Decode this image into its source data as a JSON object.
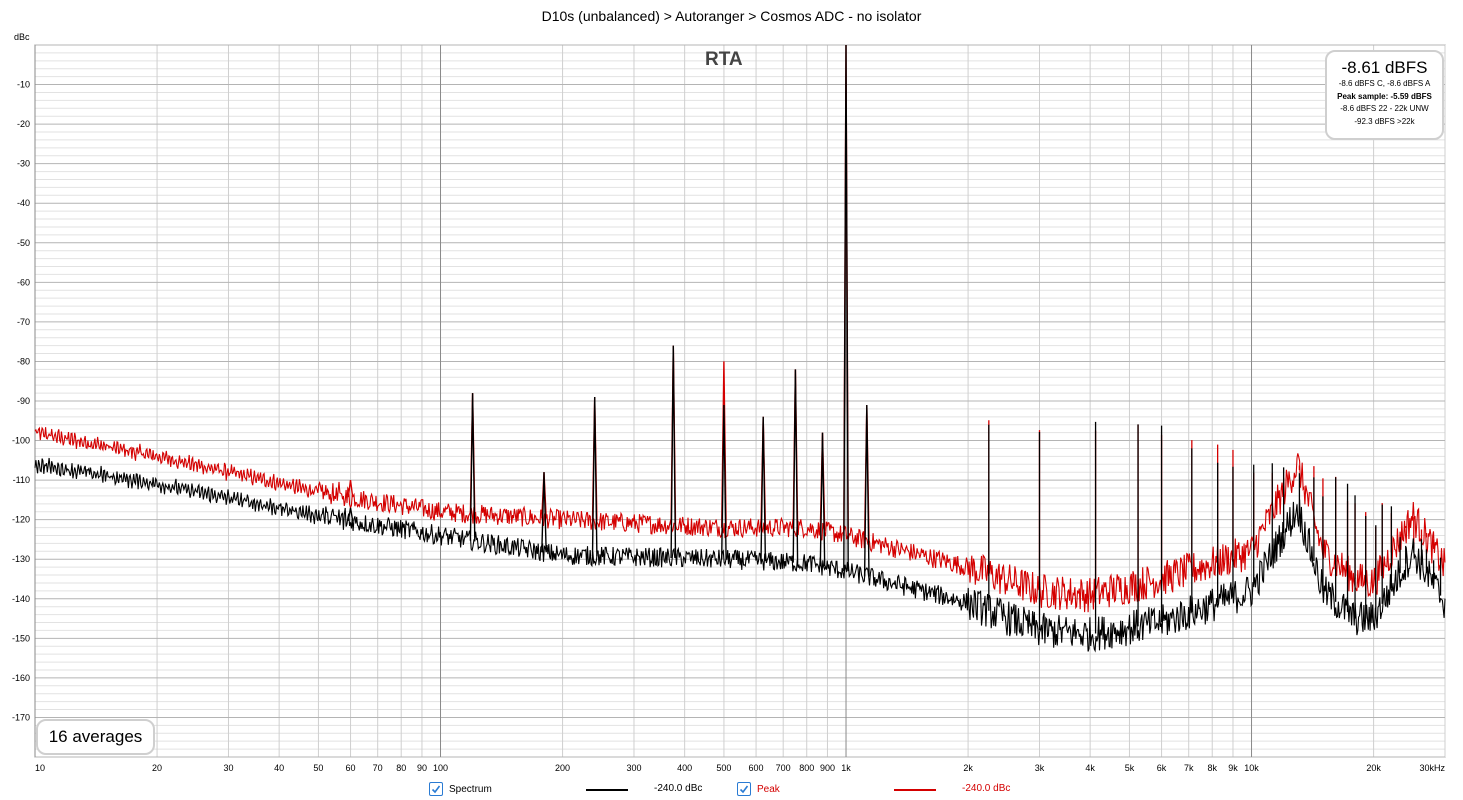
{
  "header": {
    "title": "D10s (unbalanced) > Autoranger > Cosmos ADC - no isolator"
  },
  "chart_data": {
    "type": "line",
    "title": "RTA",
    "ylabel": "dBc",
    "xscale": "log",
    "xlim": [
      10,
      30000
    ],
    "ylim": [
      -180,
      0
    ],
    "y_ticks": [
      -10,
      -20,
      -30,
      -40,
      -50,
      -60,
      -70,
      -80,
      -90,
      -100,
      -110,
      -120,
      -130,
      -140,
      -150,
      -160,
      -170
    ],
    "x_ticks": [
      {
        "v": 10,
        "label": "10"
      },
      {
        "v": 20,
        "label": "20"
      },
      {
        "v": 30,
        "label": "30"
      },
      {
        "v": 40,
        "label": "40"
      },
      {
        "v": 50,
        "label": "50"
      },
      {
        "v": 60,
        "label": "60"
      },
      {
        "v": 70,
        "label": "70"
      },
      {
        "v": 80,
        "label": "80"
      },
      {
        "v": 90,
        "label": "90"
      },
      {
        "v": 100,
        "label": "100"
      },
      {
        "v": 200,
        "label": "200"
      },
      {
        "v": 300,
        "label": "300"
      },
      {
        "v": 400,
        "label": "400"
      },
      {
        "v": 500,
        "label": "500"
      },
      {
        "v": 600,
        "label": "600"
      },
      {
        "v": 700,
        "label": "700"
      },
      {
        "v": 800,
        "label": "800"
      },
      {
        "v": 900,
        "label": "900"
      },
      {
        "v": 1000,
        "label": "1k"
      },
      {
        "v": 2000,
        "label": "2k"
      },
      {
        "v": 3000,
        "label": "3k"
      },
      {
        "v": 4000,
        "label": "4k"
      },
      {
        "v": 5000,
        "label": "5k"
      },
      {
        "v": 6000,
        "label": "6k"
      },
      {
        "v": 7000,
        "label": "7k"
      },
      {
        "v": 8000,
        "label": "8k"
      },
      {
        "v": 9000,
        "label": "9k"
      },
      {
        "v": 10000,
        "label": "10k"
      },
      {
        "v": 20000,
        "label": "20k"
      },
      {
        "v": 30000,
        "label": "30kHz"
      }
    ],
    "grid": true,
    "series": [
      {
        "name": "Spectrum",
        "color": "#000000",
        "x": [
          10,
          20,
          50,
          100,
          200,
          500,
          800,
          1000,
          2000,
          3000,
          4000,
          6000,
          10000,
          13000,
          15000,
          18000,
          20000,
          25000,
          30000
        ],
        "y": [
          -106,
          -111,
          -119,
          -124,
          -129,
          -130,
          -131,
          -133,
          -141,
          -148,
          -149,
          -146,
          -138,
          -117,
          -138,
          -145,
          -145,
          -128,
          -141
        ],
        "peaks": [
          {
            "f": 60,
            "db": -117
          },
          {
            "f": 120,
            "db": -88
          },
          {
            "f": 180,
            "db": -108
          },
          {
            "f": 240,
            "db": -89
          },
          {
            "f": 375,
            "db": -76
          },
          {
            "f": 500,
            "db": -91
          },
          {
            "f": 625,
            "db": -94
          },
          {
            "f": 750,
            "db": -82
          },
          {
            "f": 875,
            "db": -98
          },
          {
            "f": 1000,
            "db": 0
          },
          {
            "f": 1125,
            "db": -91
          }
        ]
      },
      {
        "name": "Peak",
        "color": "#d40000",
        "x": [
          10,
          20,
          50,
          100,
          200,
          500,
          800,
          1000,
          2000,
          3000,
          4000,
          6000,
          10000,
          13000,
          15000,
          18000,
          20000,
          25000,
          30000
        ],
        "y": [
          -98,
          -104,
          -113,
          -118,
          -120,
          -122,
          -122,
          -124,
          -132,
          -138,
          -139,
          -135,
          -128,
          -106,
          -128,
          -135,
          -136,
          -119,
          -132
        ],
        "peaks": [
          {
            "f": 60,
            "db": -110
          },
          {
            "f": 120,
            "db": -88
          },
          {
            "f": 180,
            "db": -108
          },
          {
            "f": 240,
            "db": -89
          },
          {
            "f": 375,
            "db": -76
          },
          {
            "f": 500,
            "db": -80
          },
          {
            "f": 625,
            "db": -94
          },
          {
            "f": 750,
            "db": -82
          },
          {
            "f": 875,
            "db": -98
          },
          {
            "f": 1000,
            "db": 0
          },
          {
            "f": 1125,
            "db": -91
          }
        ]
      }
    ]
  },
  "readout": {
    "main": "-8.61 dBFS",
    "line1": "-8.6 dBFS C, -8.6 dBFS A",
    "line2": "Peak sample: -5.59 dBFS",
    "line3": "-8.6 dBFS 22 - 22k UNW",
    "line4": "-92.3 dBFS >22k"
  },
  "averages": "16 averages",
  "legend": [
    {
      "label": "Spectrum",
      "value": "-240.0 dBc",
      "color": "#000000"
    },
    {
      "label": "Peak",
      "value": "-240.0 dBc",
      "color": "#d40000"
    }
  ]
}
